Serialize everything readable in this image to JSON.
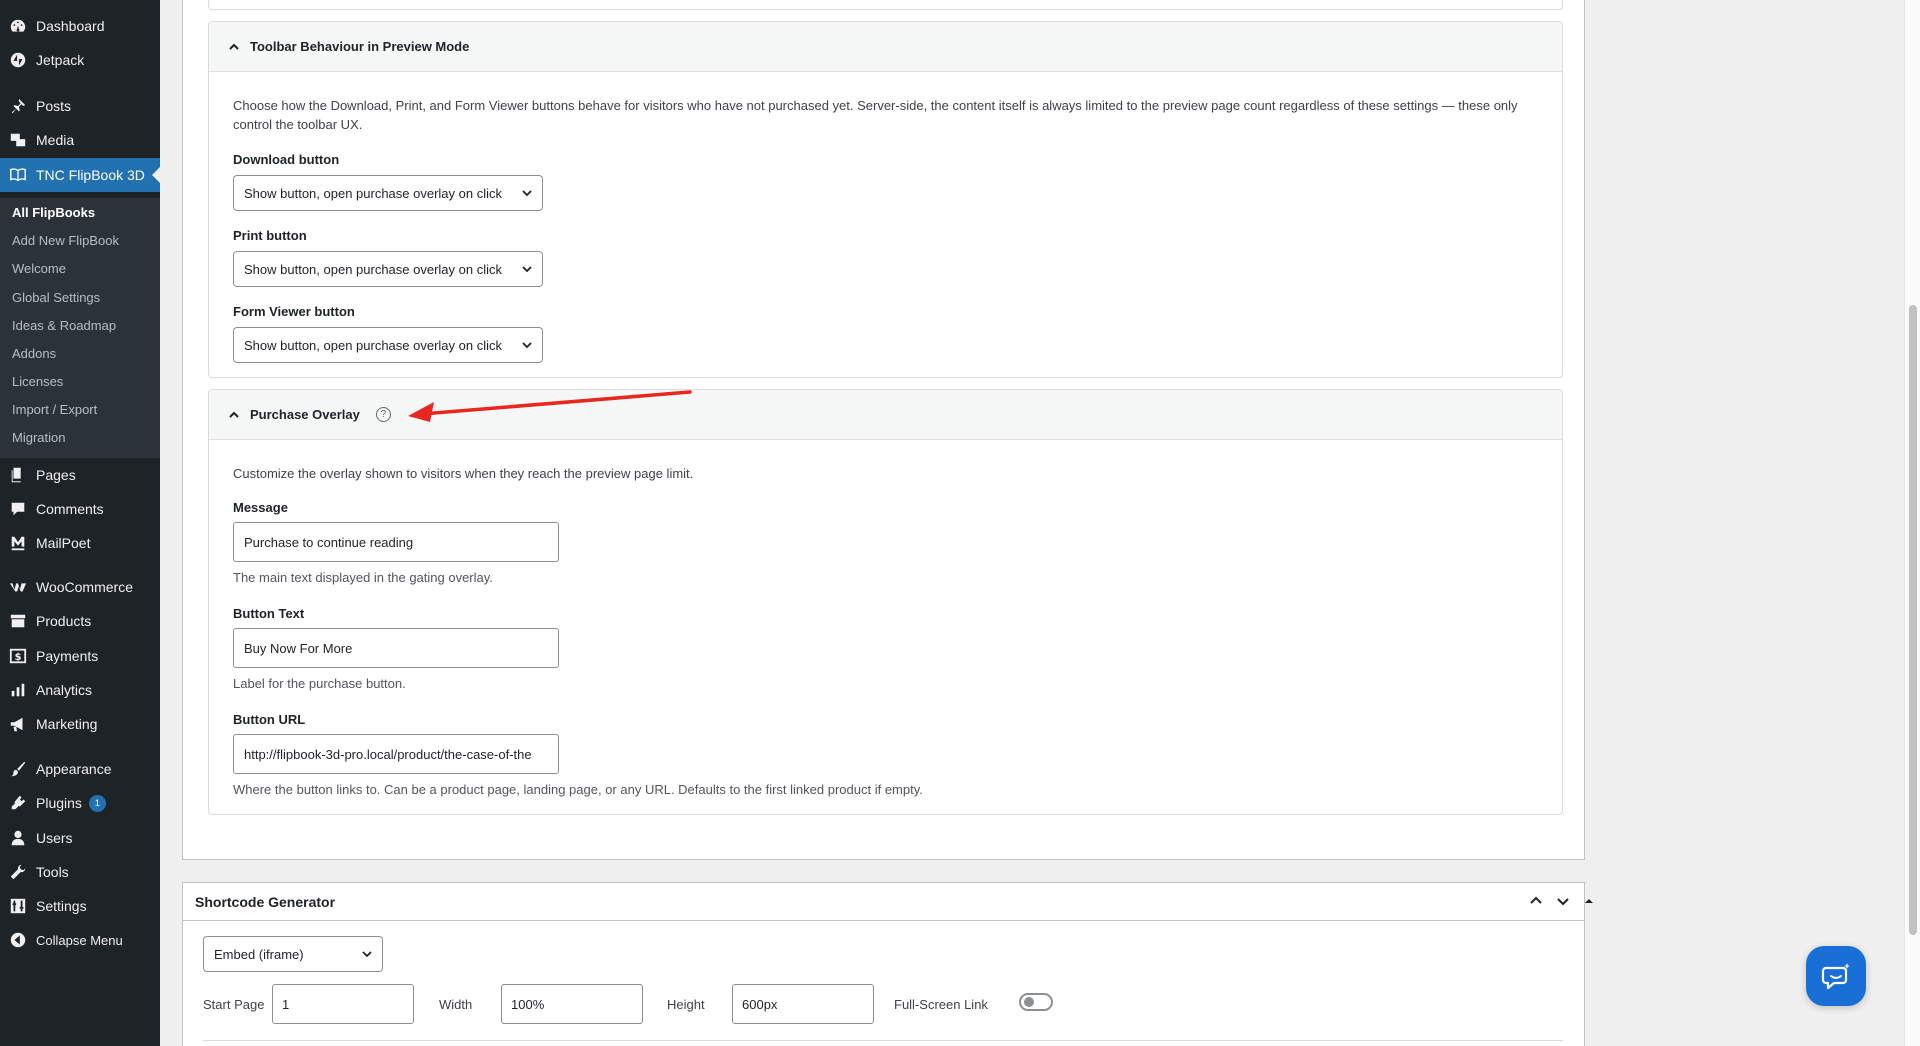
{
  "sidebar": {
    "menu": [
      {
        "label": "Dashboard",
        "icon": "dashboard-icon"
      },
      {
        "label": "Jetpack",
        "icon": "jetpack-icon"
      },
      {
        "label": "Posts",
        "icon": "pin-icon"
      },
      {
        "label": "Media",
        "icon": "media-icon"
      },
      {
        "label": "TNC FlipBook 3D",
        "icon": "flipbook-icon"
      },
      {
        "label": "Pages",
        "icon": "pages-icon"
      },
      {
        "label": "Comments",
        "icon": "comment-icon"
      },
      {
        "label": "MailPoet",
        "icon": "mailpoet-icon"
      },
      {
        "label": "WooCommerce",
        "icon": "woo-icon"
      },
      {
        "label": "Products",
        "icon": "archive-icon"
      },
      {
        "label": "Payments",
        "icon": "dollar-icon"
      },
      {
        "label": "Analytics",
        "icon": "bar-chart-icon"
      },
      {
        "label": "Marketing",
        "icon": "megaphone-icon"
      },
      {
        "label": "Appearance",
        "icon": "brush-icon"
      },
      {
        "label": "Plugins",
        "icon": "plug-icon",
        "badge": "1"
      },
      {
        "label": "Users",
        "icon": "user-icon"
      },
      {
        "label": "Tools",
        "icon": "wrench-icon"
      },
      {
        "label": "Settings",
        "icon": "settings-icon"
      },
      {
        "label": "Collapse Menu",
        "icon": "collapse-icon"
      }
    ],
    "submenu": [
      "All FlipBooks",
      "Add New FlipBook",
      "Welcome",
      "Global Settings",
      "Ideas & Roadmap",
      "Addons",
      "Licenses",
      "Import / Export",
      "Migration"
    ]
  },
  "toolbar_panel": {
    "title": "Toolbar Behaviour in Preview Mode",
    "description": "Choose how the Download, Print, and Form Viewer buttons behave for visitors who have not purchased yet. Server-side, the content itself is always limited to the preview page count regardless of these settings — these only control the toolbar UX.",
    "download_label": "Download button",
    "download_value": "Show button, open purchase overlay on click",
    "print_label": "Print button",
    "print_value": "Show button, open purchase overlay on click",
    "formviewer_label": "Form Viewer button",
    "formviewer_value": "Show button, open purchase overlay on click"
  },
  "overlay_panel": {
    "title": "Purchase Overlay",
    "help_glyph": "?",
    "description": "Customize the overlay shown to visitors when they reach the preview page limit.",
    "message_label": "Message",
    "message_value": "Purchase to continue reading",
    "message_help": "The main text displayed in the gating overlay.",
    "button_text_label": "Button Text",
    "button_text_value": "Buy Now For More",
    "button_text_help": "Label for the purchase button.",
    "button_url_label": "Button URL",
    "button_url_value": "http://flipbook-3d-pro.local/product/the-case-of-the",
    "button_url_help": "Where the button links to. Can be a product page, landing page, or any URL. Defaults to the first linked product if empty."
  },
  "shortcode": {
    "title": "Shortcode Generator",
    "mode_value": "Embed (iframe)",
    "start_page_label": "Start Page",
    "start_page_value": "1",
    "width_label": "Width",
    "width_value": "100%",
    "height_label": "Height",
    "height_value": "600px",
    "fullscreen_label": "Full-Screen Link",
    "fullscreen_on": false
  },
  "colors": {
    "sidebar_bg": "#1d2327",
    "accent": "#2271b1",
    "annotation_arrow": "#e8271e",
    "chat_button": "#1a6fd6"
  }
}
